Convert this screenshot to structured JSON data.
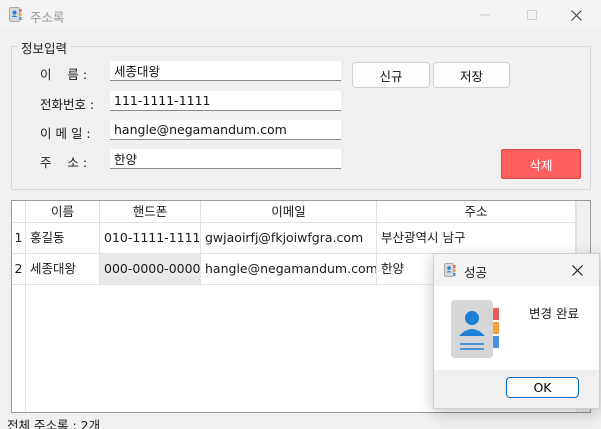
{
  "window": {
    "title": "주소록"
  },
  "form": {
    "group_title": "정보입력",
    "fields": [
      {
        "label": "이    름 :",
        "value": "세종대왕"
      },
      {
        "label": "전화번호 :",
        "value": "111-1111-1111"
      },
      {
        "label": "이 메 일 :",
        "value": "hangle@negamandum.com"
      },
      {
        "label": "주    소 :",
        "value": "한양"
      }
    ],
    "new_label": "신규",
    "save_label": "저장",
    "delete_label": "삭제"
  },
  "grid": {
    "columns": [
      "이름",
      "핸드폰",
      "이메일",
      "주소"
    ],
    "rows": [
      {
        "num": "1",
        "cells": [
          "홍길동",
          "010-1111-1111",
          "gwjaoirfj@fkjoiwfgra.com",
          "부산광역시 남구"
        ]
      },
      {
        "num": "2",
        "cells": [
          "세종대왕",
          "000-0000-0000",
          "hangle@negamandum.com",
          "한양"
        ]
      }
    ]
  },
  "status": {
    "text": "전체 주소록 : 2개"
  },
  "dialog": {
    "title": "성공",
    "message": "변경 완료",
    "ok_label": "OK"
  },
  "icons": {
    "app": "contact-book-icon",
    "minimize": "minimize-icon",
    "maximize": "maximize-icon",
    "close": "close-icon",
    "dialog_app": "contact-book-icon",
    "dialog_close": "close-icon",
    "dialog_body": "contact-book-icon"
  },
  "colors": {
    "delete": "#ff5f5f",
    "ok_border": "#0067c0",
    "accent_person": "#1e7fd6"
  }
}
